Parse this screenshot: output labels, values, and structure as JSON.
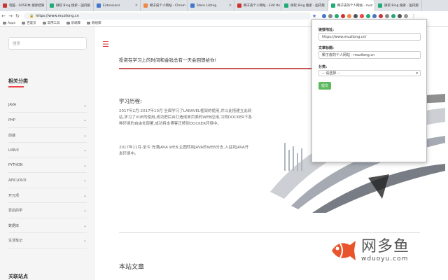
{
  "browser": {
    "tabs": [
      {
        "label": "电脑 - SOSO本 搜索结果",
        "color": "#c33"
      },
      {
        "label": "微软 Bing 搜索 - 国内版",
        "color": "#2a7"
      },
      {
        "label": "Extensions",
        "color": "#47c"
      },
      {
        "label": "椰子皮个人网站 - Chrom",
        "color": "#e84"
      },
      {
        "label": "Store Listing",
        "color": "#47c"
      },
      {
        "label": "椰子皮个人网站 - Edit Ite",
        "color": "#c33"
      },
      {
        "label": "微软 Bing 搜索 - 国内版",
        "color": "#2a7"
      },
      {
        "label": "椰子皮的个人网站 - muz",
        "color": "#2a7",
        "active": true
      },
      {
        "label": "微软 Bing 搜索 - 国内版",
        "color": "#2a7"
      }
    ],
    "url": "https://www.muzilong.cn",
    "bookmarks": [
      "Apps",
      "百度页",
      "常用工具",
      "前端库",
      "数组库"
    ]
  },
  "sidebar": {
    "search_placeholder": "搜索",
    "heading": "相关分类",
    "categories": [
      "JAVA",
      "PHP",
      "前端",
      "LINUX",
      "PYTHON",
      "APICLOUD",
      "开元项",
      "爱后的学",
      "数据库",
      "生活笔记"
    ],
    "footer_heading": "关联站点"
  },
  "main": {
    "quote": "投资在学习上的时间和金钱总有一天会回馈给你!",
    "history_title": "学习历程:",
    "history_p1": "2017年2月-2017年10月  全面学习了LARAVEL框架的使用,并以此搭建立此网站,学习了VUE的使用,成功把后台打造成单页面的WEB应用,习得DOCKER下各种环境的自由化部署,成功将本博客迁移到DOCKER环境中。",
    "history_p2": "2017年11月-至今  充满JAVA WEB,企图转用JAVA的WEB分支,入驻到JAVA开发环境中。",
    "site_articles": "本站文章"
  },
  "popup": {
    "link_label": "链接地址:",
    "link_value": "https://www.muzilong.cn/",
    "title_label": "文章标题:",
    "title_value": "椰子皮的个人网站 - muzilong.cn",
    "category_label": "分类:",
    "category_value": "-- 请选择 --",
    "submit_label": "提交"
  },
  "watermark": {
    "cn": "网多鱼",
    "en": "wduoyu.com"
  }
}
